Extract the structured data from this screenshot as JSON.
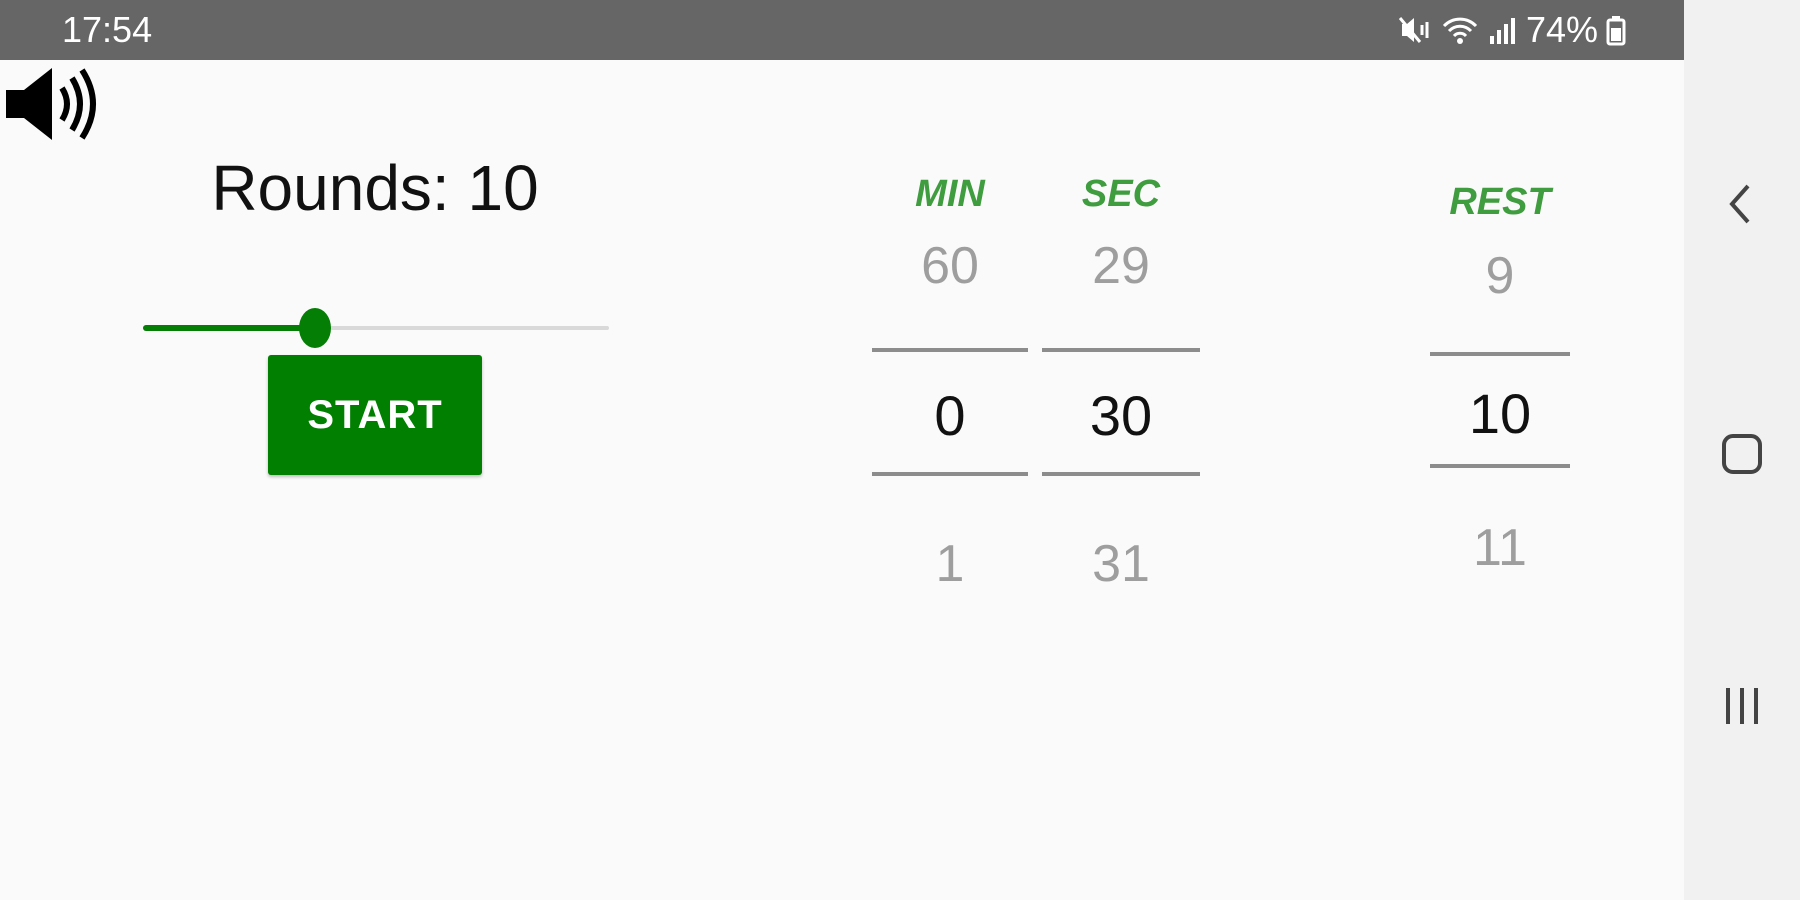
{
  "status_bar": {
    "time": "17:54",
    "battery_percent": "74%",
    "icons": [
      "mute-vibrate-icon",
      "wifi-icon",
      "signal-icon",
      "battery-icon"
    ]
  },
  "app": {
    "sound_icon": "speaker-icon",
    "rounds": {
      "label": "Rounds: 10",
      "slider_fraction": 0.37
    },
    "start_button": {
      "label": "START",
      "color": "#007f00"
    },
    "pickers": {
      "min": {
        "label": "MIN",
        "prev": "60",
        "current": "0",
        "next": "1"
      },
      "sec": {
        "label": "SEC",
        "prev": "29",
        "current": "30",
        "next": "31"
      },
      "rest": {
        "label": "REST",
        "prev": "9",
        "current": "10",
        "next": "11"
      }
    },
    "colors": {
      "accent": "#057e05",
      "picker_label": "#3f9c3f"
    }
  },
  "nav_bar": {
    "buttons": [
      "back-icon",
      "home-icon",
      "recents-icon"
    ]
  }
}
